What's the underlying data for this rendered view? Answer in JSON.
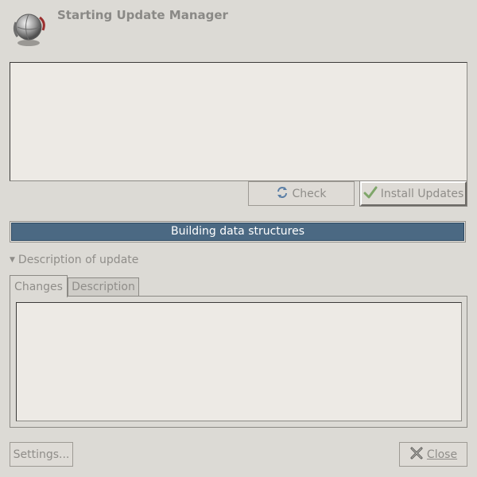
{
  "window": {
    "title": "Starting Update Manager",
    "icon": "update-manager-globe-icon"
  },
  "buttons": {
    "check": "Check",
    "check_icon": "refresh-icon",
    "install": "Install Updates",
    "install_icon": "checkmark-icon",
    "settings": "Settings...",
    "close": "Close",
    "close_icon": "close-x-icon"
  },
  "progress": {
    "text": "Building data structures",
    "fraction": 1.0
  },
  "expander": {
    "label": "Description of update",
    "expanded": true
  },
  "tabs": [
    {
      "label": "Changes",
      "active": true
    },
    {
      "label": "Description",
      "active": false
    }
  ],
  "colors": {
    "progress_fill": "#4b6983",
    "window_bg": "#dcdad5"
  }
}
